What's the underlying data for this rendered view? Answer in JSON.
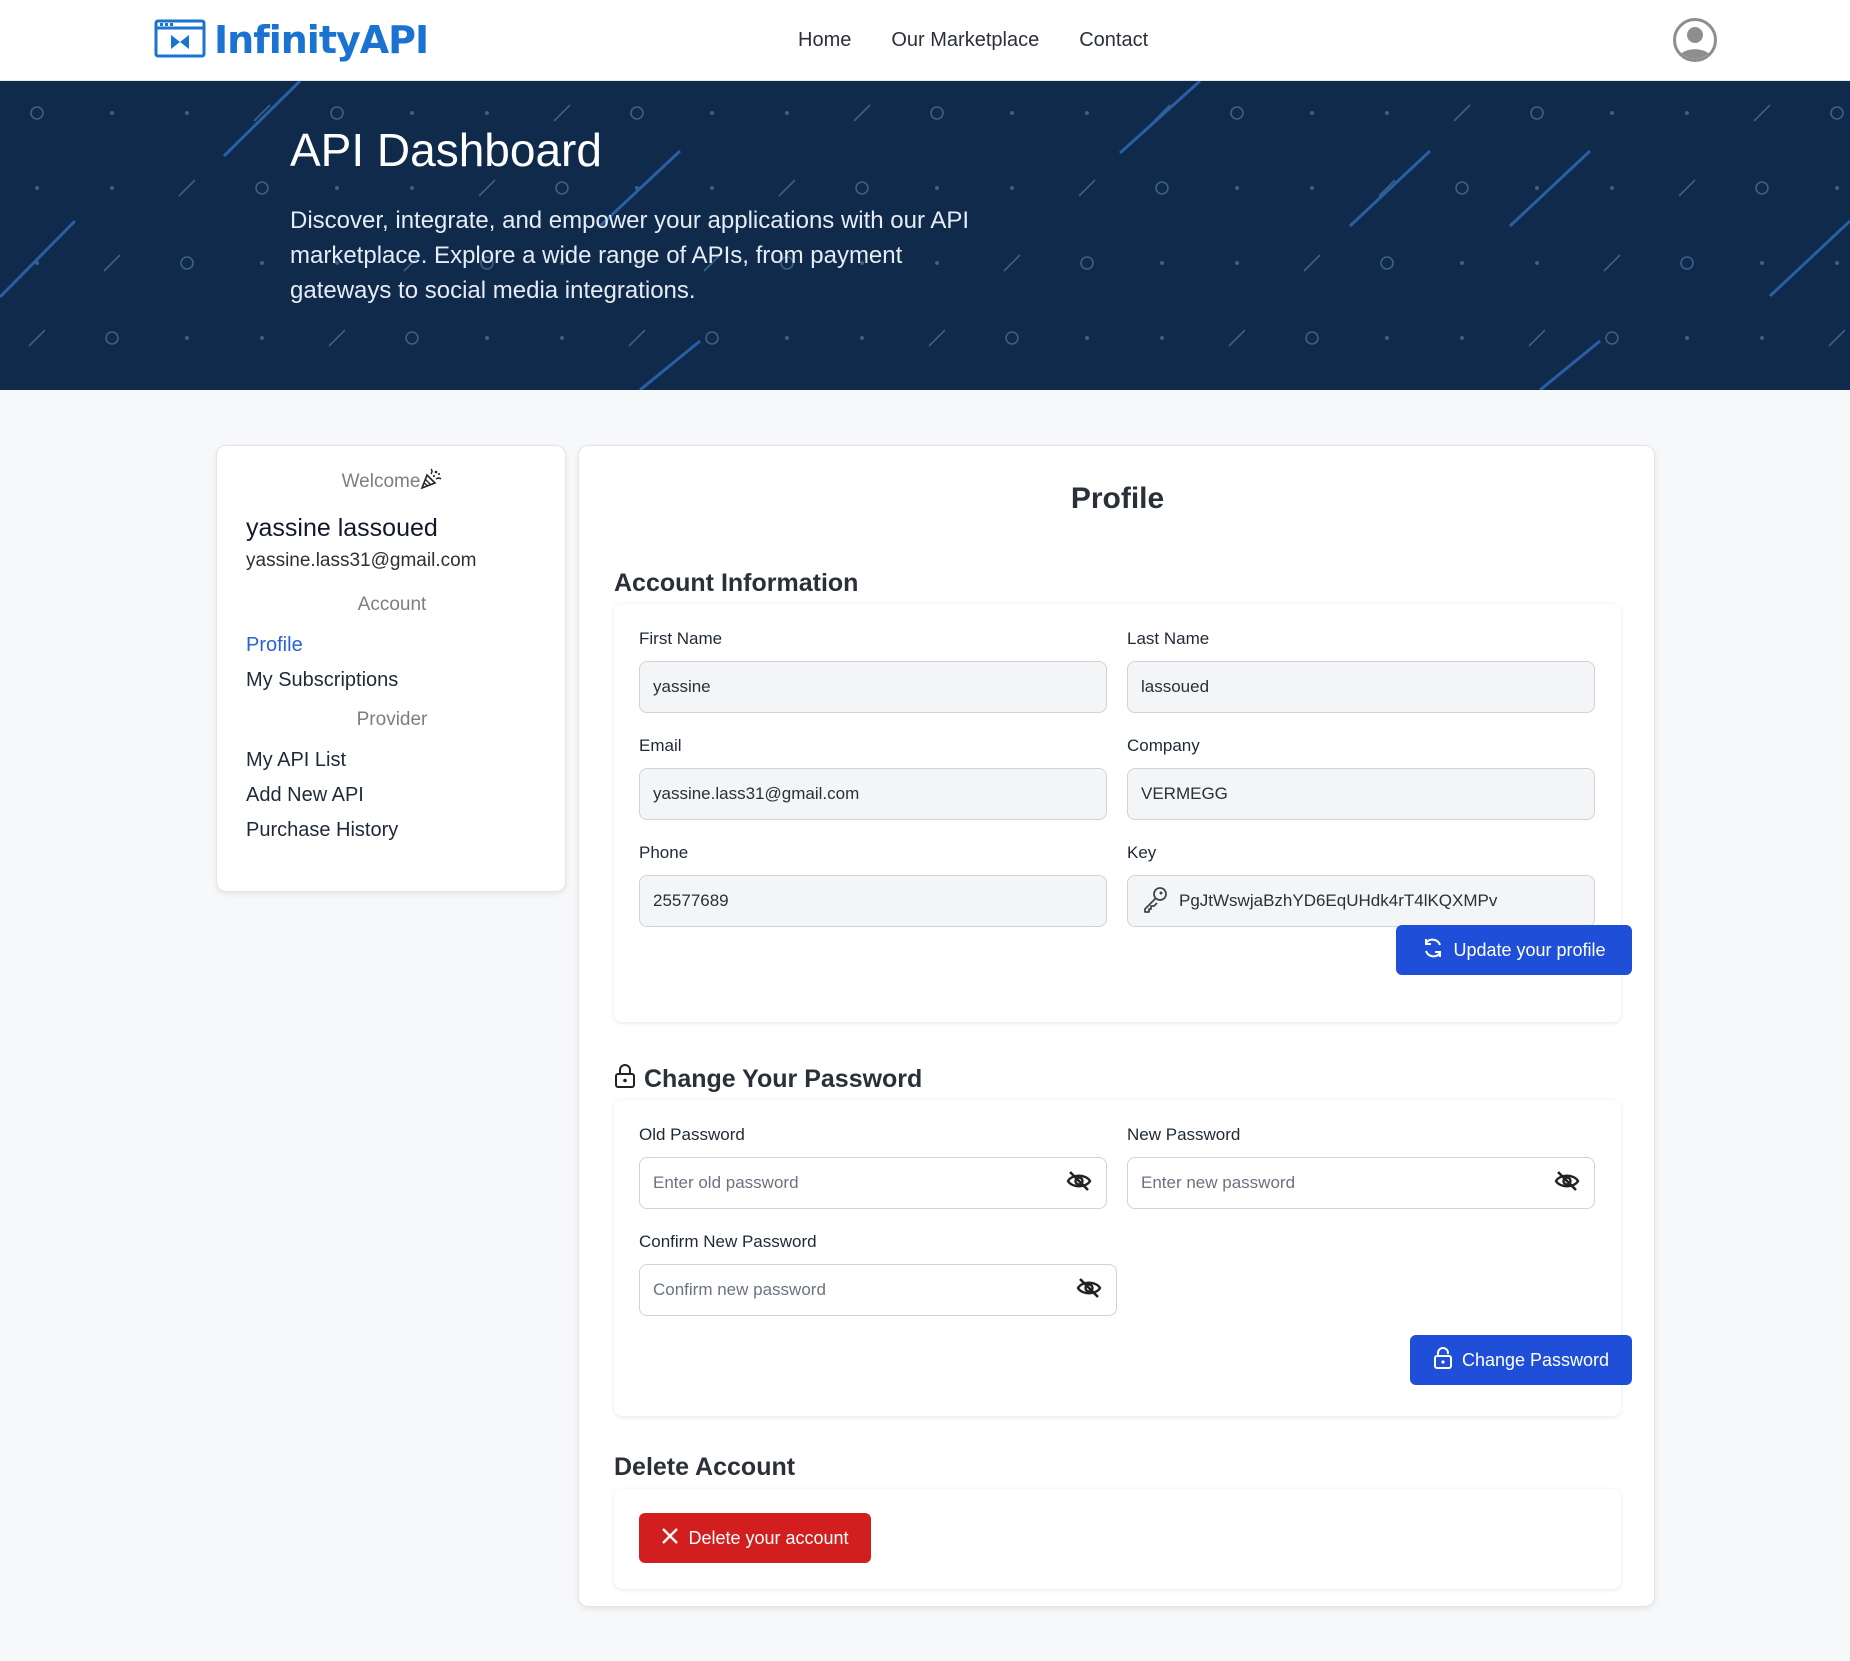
{
  "brand": {
    "name": "InfinityAPI"
  },
  "nav": {
    "links": [
      "Home",
      "Our Marketplace",
      "Contact"
    ],
    "avatar_icon": "user-avatar-icon"
  },
  "hero": {
    "title": "API Dashboard",
    "description": "Discover, integrate, and empower your applications with our API marketplace. Explore a wide range of APIs, from payment gateways to social media integrations."
  },
  "sidebar": {
    "welcome": "Welcome",
    "user_name": "yassine lassoued",
    "user_email": "yassine.lass31@gmail.com",
    "account_heading": "Account",
    "account_items": [
      "Profile",
      "My Subscriptions"
    ],
    "provider_heading": "Provider",
    "provider_items": [
      "My API List",
      "Add New API",
      "Purchase History"
    ],
    "active_item": "Profile"
  },
  "profile": {
    "title": "Profile",
    "account_info": {
      "heading": "Account Information",
      "first_name_label": "First Name",
      "first_name": "yassine",
      "last_name_label": "Last Name",
      "last_name": "lassoued",
      "email_label": "Email",
      "email": "yassine.lass31@gmail.com",
      "company_label": "Company",
      "company": "VERMEGG",
      "phone_label": "Phone",
      "phone": "25577689",
      "key_label": "Key",
      "key": "PgJtWswjaBzhYD6EqUHdk4rT4lKQXMPv",
      "update_button": "Update your profile"
    },
    "password": {
      "heading": "Change Your Password",
      "old_label": "Old Password",
      "old_placeholder": "Enter old password",
      "new_label": "New Password",
      "new_placeholder": "Enter new password",
      "confirm_label": "Confirm New Password",
      "confirm_placeholder": "Confirm new password",
      "change_button": "Change Password"
    },
    "delete": {
      "heading": "Delete Account",
      "button": "Delete your account"
    }
  },
  "colors": {
    "primary": "#1f4fd8",
    "brand": "#1a73d1",
    "danger": "#d21e1e",
    "hero_bg": "#0f2a4a",
    "active_link": "#2a62d6"
  }
}
